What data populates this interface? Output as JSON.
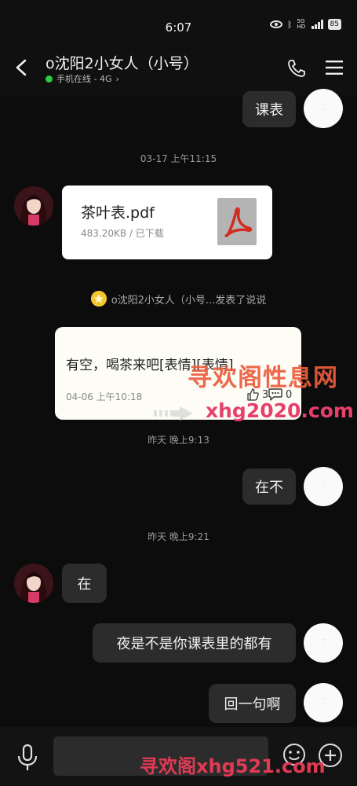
{
  "status_bar": {
    "time": "6:07",
    "battery": "85"
  },
  "header": {
    "title": "o沈阳2小女人（小号）",
    "subtitle": "手机在线 - 4G",
    "subtitle_arrow": "›"
  },
  "messages": {
    "m1": "课表",
    "ts1": "03-17 上午11:15",
    "file": {
      "name": "茶叶表.pdf",
      "meta": "483.20KB / 已下载"
    },
    "notice": "o沈阳2小女人（小号...发表了说说",
    "post": {
      "text": "有空，喝茶来吧[表情][表情]",
      "date": "04-06 上午10:18",
      "likes": "3",
      "comments": "0"
    },
    "ts2": "昨天 晚上9:13",
    "m2": "在不",
    "ts3": "昨天 晚上9:21",
    "m3": "在",
    "m4": "夜是不是你课表里的都有",
    "m5": "回一句啊"
  },
  "watermarks": {
    "w1": "寻欢阁性息网",
    "w2": "xhg2020.com",
    "w3": "寻欢阁xhg521.com"
  },
  "colors": {
    "online": "#2ecc40",
    "pdf_red": "#d22b20",
    "bubble": "#2c2c2c"
  },
  "icons": [
    "back-icon",
    "phone-icon",
    "menu-icon",
    "pdf-icon",
    "star-icon",
    "thumbs-up-icon",
    "comment-icon",
    "mic-icon",
    "emoji-icon",
    "plus-icon"
  ]
}
